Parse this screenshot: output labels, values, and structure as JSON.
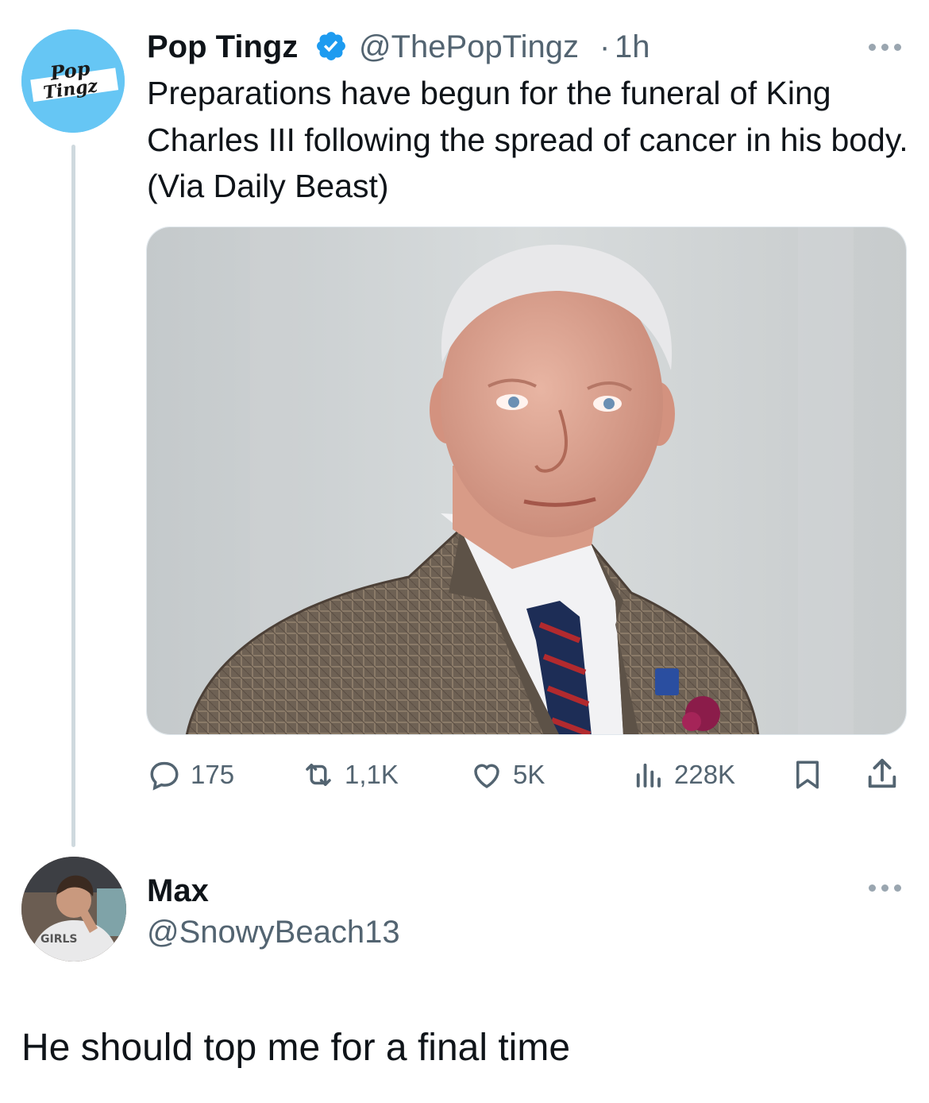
{
  "tweet": {
    "author_name": "Pop Tingz",
    "handle": "@ThePopTingz",
    "separator": "·",
    "time": "1h",
    "avatar_text": [
      "Pop",
      "Tingz"
    ],
    "text": "Preparations have begun for the funeral of King Charles III following the spread of cancer in his body. (Via Daily Beast)",
    "verified_icon": "verified-badge-icon",
    "stats": {
      "replies": "175",
      "retweets": "1,1K",
      "likes": "5K",
      "views": "228K"
    }
  },
  "reply": {
    "author_name": "Max",
    "handle": "@SnowyBeach13",
    "text": "He should top me for a final time"
  },
  "colors": {
    "accent": "#1d9bf0",
    "secondary_text": "#536471",
    "thread_line": "#cfd9de",
    "pop_avatar_bg": "#66c6f4"
  }
}
